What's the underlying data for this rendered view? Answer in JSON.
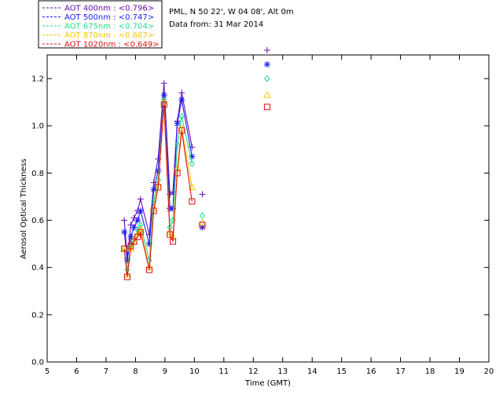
{
  "info": {
    "site": "PML, N 50 22', W 04 08', Alt 0m",
    "date": "Data from: 31 Mar 2014"
  },
  "chart_data": {
    "type": "line",
    "title": "",
    "xlabel": "Time (GMT)",
    "ylabel": "Aerosol Optical Thickness",
    "xlim": [
      5,
      20
    ],
    "ylim": [
      0,
      1.3
    ],
    "xticks": [
      5,
      6,
      7,
      8,
      9,
      10,
      11,
      12,
      13,
      14,
      15,
      16,
      17,
      18,
      19,
      20
    ],
    "yticks": [
      0.0,
      0.2,
      0.4,
      0.6,
      0.8,
      1.0,
      1.2
    ],
    "ytick_labels": [
      "0.0",
      "0.2",
      "0.4",
      "0.6",
      "0.8",
      "1.0",
      "1.2"
    ],
    "legend_position": "top-left",
    "grid": false,
    "series": [
      {
        "name": "AOT  400nm : <0.796>",
        "color": "#6a0dad",
        "marker": "plus",
        "points": [
          [
            7.62,
            0.6
          ],
          [
            7.72,
            0.44
          ],
          [
            7.84,
            0.58
          ],
          [
            7.95,
            0.61
          ],
          [
            8.07,
            0.64
          ],
          [
            8.17,
            0.69
          ],
          [
            8.47,
            0.54
          ],
          [
            8.62,
            0.76
          ],
          [
            8.77,
            0.86
          ],
          [
            8.97,
            1.18
          ],
          [
            9.17,
            0.71
          ],
          [
            9.27,
            0.72
          ],
          [
            9.42,
            1.02
          ],
          [
            9.57,
            1.14
          ],
          [
            9.92,
            0.91
          ],
          [
            10.27,
            0.71
          ],
          [
            12.47,
            1.32
          ]
        ],
        "segments": [
          [
            0,
            6
          ],
          [
            6,
            14
          ]
        ]
      },
      {
        "name": "AOT  500nm : <0.747>",
        "color": "#1a1aff",
        "marker": "asterisk",
        "points": [
          [
            7.62,
            0.55
          ],
          [
            7.72,
            0.43
          ],
          [
            7.84,
            0.53
          ],
          [
            7.95,
            0.57
          ],
          [
            8.07,
            0.6
          ],
          [
            8.17,
            0.64
          ],
          [
            8.47,
            0.5
          ],
          [
            8.62,
            0.73
          ],
          [
            8.77,
            0.81
          ],
          [
            8.97,
            1.13
          ],
          [
            9.17,
            0.65
          ],
          [
            9.27,
            0.65
          ],
          [
            9.42,
            1.01
          ],
          [
            9.57,
            1.11
          ],
          [
            9.92,
            0.87
          ],
          [
            10.27,
            0.57
          ],
          [
            12.47,
            1.26
          ]
        ],
        "segments": [
          [
            0,
            6
          ],
          [
            6,
            14
          ]
        ]
      },
      {
        "name": "AOT  675nm : <0.704>",
        "color": "#22dd88",
        "marker": "diamond",
        "points": [
          [
            7.62,
            0.48
          ],
          [
            7.72,
            0.39
          ],
          [
            7.84,
            0.49
          ],
          [
            7.95,
            0.52
          ],
          [
            8.07,
            0.56
          ],
          [
            8.17,
            0.58
          ],
          [
            8.47,
            0.43
          ],
          [
            8.62,
            0.68
          ],
          [
            8.77,
            0.77
          ],
          [
            8.97,
            1.11
          ],
          [
            9.17,
            0.57
          ],
          [
            9.27,
            0.6
          ],
          [
            9.42,
            0.92
          ],
          [
            9.57,
            1.04
          ],
          [
            9.92,
            0.84
          ],
          [
            10.27,
            0.62
          ],
          [
            12.47,
            1.2
          ]
        ],
        "segments": [
          [
            0,
            6
          ],
          [
            6,
            14
          ]
        ]
      },
      {
        "name": "AOT  870nm : <0.667>",
        "color": "#f5c800",
        "marker": "triangle",
        "points": [
          [
            7.62,
            0.48
          ],
          [
            7.72,
            0.37
          ],
          [
            7.84,
            0.48
          ],
          [
            7.95,
            0.51
          ],
          [
            8.07,
            0.54
          ],
          [
            8.17,
            0.56
          ],
          [
            8.47,
            0.4
          ],
          [
            8.62,
            0.65
          ],
          [
            8.77,
            0.75
          ],
          [
            8.97,
            1.1
          ],
          [
            9.17,
            0.55
          ],
          [
            9.27,
            0.53
          ],
          [
            9.42,
            0.82
          ],
          [
            9.57,
            0.99
          ],
          [
            9.92,
            0.74
          ],
          [
            10.27,
            0.59
          ],
          [
            12.47,
            1.13
          ]
        ],
        "segments": [
          [
            0,
            6
          ],
          [
            6,
            14
          ]
        ]
      },
      {
        "name": "AOT 1020nm : <0.649>",
        "color": "#dd1111",
        "marker": "square",
        "points": [
          [
            7.62,
            0.48
          ],
          [
            7.72,
            0.36
          ],
          [
            7.84,
            0.49
          ],
          [
            7.95,
            0.51
          ],
          [
            8.07,
            0.53
          ],
          [
            8.17,
            0.55
          ],
          [
            8.47,
            0.39
          ],
          [
            8.62,
            0.64
          ],
          [
            8.77,
            0.74
          ],
          [
            8.97,
            1.09
          ],
          [
            9.17,
            0.54
          ],
          [
            9.27,
            0.51
          ],
          [
            9.42,
            0.8
          ],
          [
            9.57,
            0.98
          ],
          [
            9.92,
            0.68
          ],
          [
            10.27,
            0.58
          ],
          [
            12.47,
            1.08
          ]
        ],
        "segments": [
          [
            0,
            6
          ],
          [
            6,
            14
          ]
        ]
      }
    ]
  }
}
